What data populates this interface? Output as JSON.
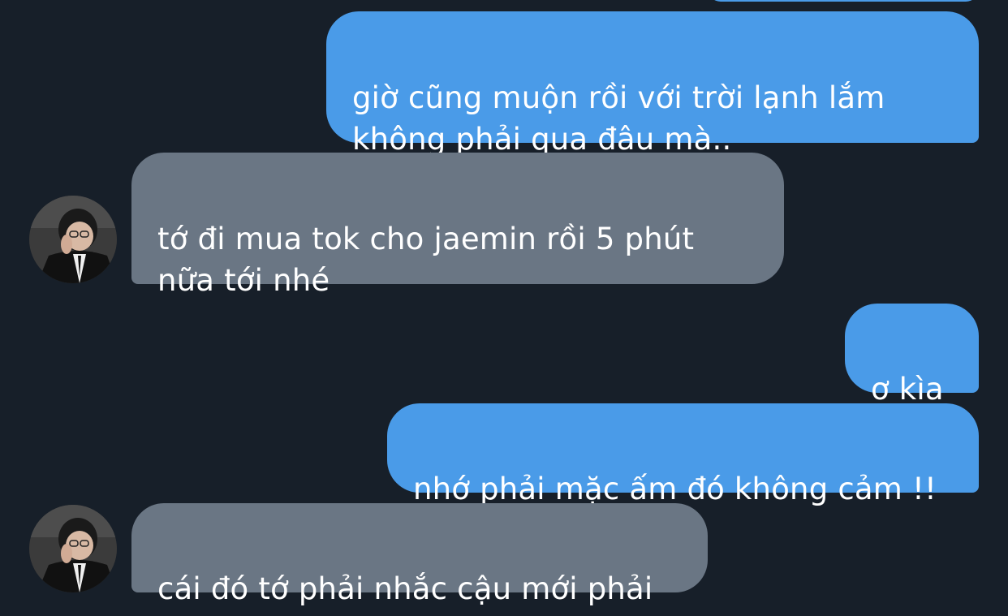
{
  "conversation": {
    "messages": [
      {
        "direction": "outgoing",
        "text": "giờ cũng muộn rồi với trời lạnh lắm\nkhông phải qua đâu mà.."
      },
      {
        "direction": "incoming",
        "text": "tớ đi mua tok cho jaemin rồi 5 phút\nnữa tới nhé"
      },
      {
        "direction": "outgoing",
        "text": "ơ kìa"
      },
      {
        "direction": "outgoing",
        "text": "nhớ phải mặc ấm đó không cảm !!"
      },
      {
        "direction": "incoming",
        "text": "cái đó tớ phải nhắc cậu mới phải"
      }
    ]
  },
  "colors": {
    "background": "#171f29",
    "outgoing_bubble": "#4a9be8",
    "incoming_bubble": "#6a7684",
    "text": "#ffffff"
  },
  "icons": {
    "contact_avatar": "avatar-icon"
  }
}
